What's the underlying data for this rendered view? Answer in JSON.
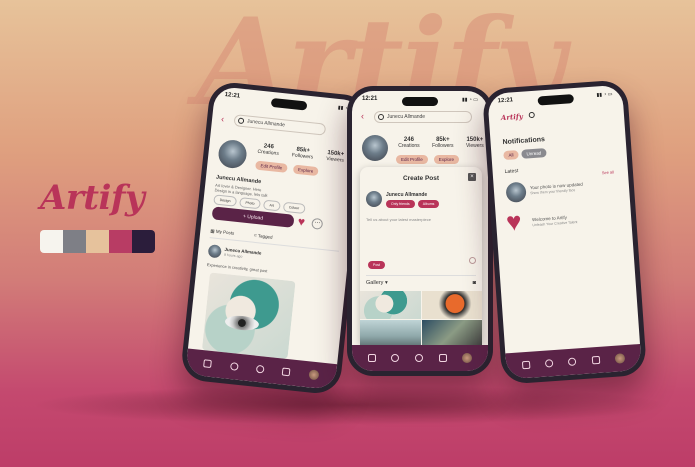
{
  "background_word": "Artify",
  "brand": {
    "logo": "Artify",
    "palette": [
      "#f6f4ee",
      "#7e7f86",
      "#e6c29c",
      "#b83c64",
      "#2b1d3b"
    ],
    "accent": "#b93459",
    "dark": "#5a2347"
  },
  "phone1": {
    "time": "12:21",
    "search_value": "Junecu Allmande",
    "back_icon": "chevron-left-icon",
    "stats": [
      {
        "value": "246",
        "label": "Creations"
      },
      {
        "value": "85k+",
        "label": "Followers"
      },
      {
        "value": "150k+",
        "label": "Viewers"
      }
    ],
    "edit_button": "Edit Profile",
    "explore_button": "Explore",
    "name": "Junecu Allmande",
    "bio_line1": "Art lover & Designer. Here",
    "bio_line2": "Design is a language. lets talk",
    "tags": [
      "Design",
      "Photo",
      "Art",
      "Colour"
    ],
    "upload_button": "+ Upload",
    "tabs": [
      "My Posts",
      "Tagged"
    ],
    "post": {
      "author": "Junecu Allmande",
      "time": "9 hours ago",
      "caption": "Experience in creativity, great post"
    }
  },
  "phone2": {
    "time": "12:21",
    "search_value": "Junecu Allmande",
    "stats": [
      {
        "value": "246",
        "label": "Creations"
      },
      {
        "value": "85k+",
        "label": "Followers"
      },
      {
        "value": "150k+",
        "label": "Viewers"
      }
    ],
    "edit_button": "Edit Profile",
    "explore_button": "Explore",
    "modal": {
      "title": "Create Post",
      "author": "Junecu Allmande",
      "visibility_options": [
        "Only friends",
        "Albums"
      ],
      "placeholder": "Tell us about your latest masterpiece",
      "post_button": "Post",
      "gallery_label": "Gallery"
    }
  },
  "phone3": {
    "time": "12:21",
    "logo": "Artify",
    "title": "Notifications",
    "filters": [
      "All",
      "Unread"
    ],
    "section_label": "Latest",
    "see_all": "See all",
    "items": [
      {
        "title": "Your photo is now updated",
        "subtitle": "Show them your friendly face"
      },
      {
        "title": "Welcome to Artify",
        "subtitle": "Unleash Your Creative Talent"
      }
    ]
  }
}
